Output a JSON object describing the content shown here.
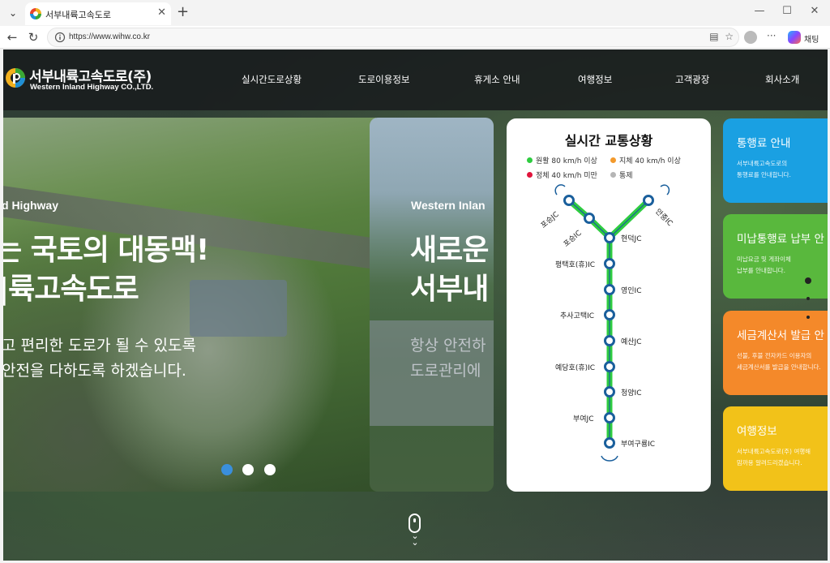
{
  "browser": {
    "tab_title": "서부내륙고속도로",
    "url": "https://www.wihw.co.kr",
    "copilot_label": "채팅"
  },
  "site": {
    "logo_ko": "서부내륙고속도로(주)",
    "logo_en": "Western Inland Highway CO.,LTD.",
    "nav": [
      "실시간도로상황",
      "도로이용정보",
      "휴게소 안내",
      "여행정보",
      "고객광장",
      "회사소개"
    ]
  },
  "hero": {
    "slide1": {
      "eyebrow": "d Highway",
      "headline1": "는 국토의 대동맥!",
      "headline2": "|륙고속도로",
      "sub1": "고 편리한 도로가 될 수 있도록",
      "sub2": "안전을 다하도록 하겠습니다."
    },
    "slide2": {
      "eyebrow": "Western Inlan",
      "headline1": "새로운",
      "headline2": "서부내",
      "sub1": "항상 안전하",
      "sub2": "도로관리에"
    }
  },
  "traffic": {
    "title": "실시간 교통상황",
    "legend": [
      {
        "label": "원활 80 km/h 이상",
        "color": "#2ecc40"
      },
      {
        "label": "지체 40 km/h 이상",
        "color": "#f39a2c"
      },
      {
        "label": "정체 40 km/h 미만",
        "color": "#e0143c"
      },
      {
        "label": "통제",
        "color": "#b5b5b5"
      }
    ],
    "stations": {
      "posong_jc": "포승JC",
      "posong_ic": "포승IC",
      "anjung_ic": "안중IC",
      "hyeondeok_jc": "현덕JC",
      "pyeongtaekho": "평택호(휴)IC",
      "yeongin_ic": "영인IC",
      "chusa": "추사고택IC",
      "yesan_jc": "예산JC",
      "yedangho": "예당호(휴)IC",
      "cheongyang_ic": "청양IC",
      "buyeo_jc": "부여JC",
      "buyeo_gu": "부여구룡IC"
    },
    "line_color": "#2ecc40",
    "node_color": "#1a5f9c"
  },
  "side_cards": [
    {
      "title": "통행료 안내",
      "desc1": "서부내륙고속도로의",
      "desc2": "통행료를 안내합니다."
    },
    {
      "title": "미납통행료 납부 안",
      "desc1": "미납요금 및 게좌이체",
      "desc2": "납부를 안내합니다."
    },
    {
      "title": "세금계산서 발급 안",
      "desc1": "선불, 후불 전자카드 이용자의",
      "desc2": "세금계산서를 발급을 안내합니다."
    },
    {
      "title": "여행정보",
      "desc1": "서부내륙고속도로(주) 여행해",
      "desc2": "맘까용 알려드리겠습니다."
    }
  ]
}
